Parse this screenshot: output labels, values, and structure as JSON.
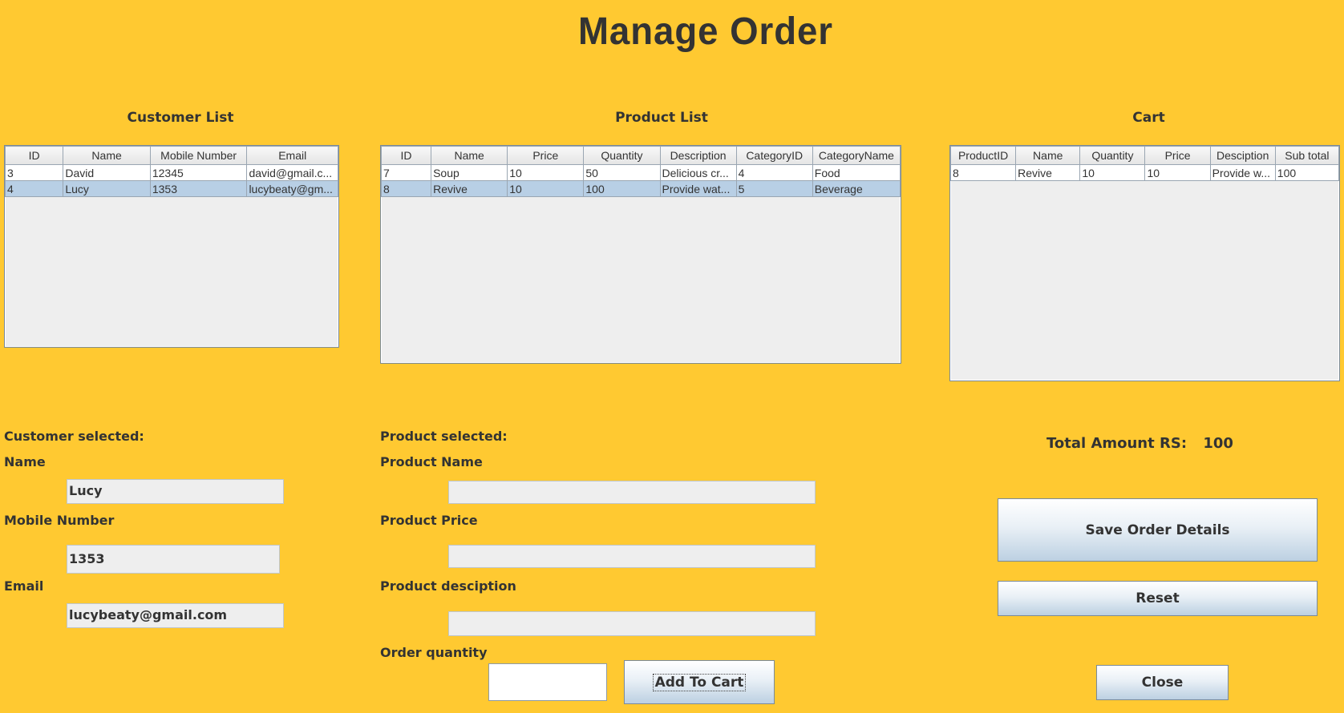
{
  "title": "Manage Order",
  "customer_list": {
    "title": "Customer List",
    "columns": [
      "ID",
      "Name",
      "Mobile Number",
      "Email"
    ],
    "rows": [
      [
        "3",
        "David",
        "12345",
        "david@gmail.c..."
      ],
      [
        "4",
        "Lucy",
        "1353",
        "lucybeaty@gm..."
      ]
    ],
    "selected_row": 1
  },
  "product_list": {
    "title": "Product List",
    "columns": [
      "ID",
      "Name",
      "Price",
      "Quantity",
      "Description",
      "CategoryID",
      "CategoryName"
    ],
    "rows": [
      [
        "7",
        "Soup",
        "10",
        "50",
        "Delicious cr...",
        "4",
        "Food"
      ],
      [
        "8",
        "Revive",
        "10",
        "100",
        "Provide wat...",
        "5",
        "Beverage"
      ]
    ],
    "selected_row": 1
  },
  "cart": {
    "title": "Cart",
    "columns": [
      "ProductID",
      "Name",
      "Quantity",
      "Price",
      "Desciption",
      "Sub total"
    ],
    "rows": [
      [
        "8",
        "Revive",
        "10",
        "10",
        "Provide w...",
        "100"
      ]
    ]
  },
  "customer_selected": {
    "heading": "Customer selected:",
    "name_label": "Name",
    "name_value": "Lucy",
    "mobile_label": "Mobile Number",
    "mobile_value": "1353",
    "email_label": "Email",
    "email_value": "lucybeaty@gmail.com"
  },
  "product_selected": {
    "heading": "Product selected:",
    "name_label": "Product Name",
    "name_value": "",
    "price_label": "Product Price",
    "price_value": "",
    "desc_label": "Product desciption",
    "desc_value": "",
    "qty_label": "Order quantity",
    "qty_value": ""
  },
  "total": {
    "label": "Total Amount RS:",
    "value": "100"
  },
  "buttons": {
    "add_to_cart": "Add To Cart",
    "save_order": "Save Order Details",
    "reset": "Reset",
    "close": "Close"
  },
  "colors": {
    "background": "#FFC931",
    "selected_row": "#B8CFE5",
    "table_bg": "#EEEEEE"
  }
}
